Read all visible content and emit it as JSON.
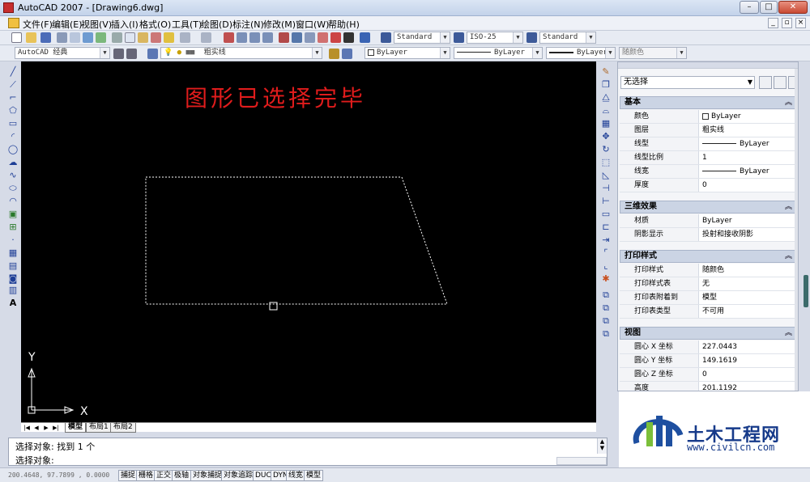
{
  "window": {
    "title": "AutoCAD 2007 - [Drawing6.dwg]",
    "minimize": "–",
    "maximize": "□",
    "close": "✕"
  },
  "menu": {
    "items": [
      "文件(F)",
      "编辑(E)",
      "视图(V)",
      "插入(I)",
      "格式(O)",
      "工具(T)",
      "绘图(D)",
      "标注(N)",
      "修改(M)",
      "窗口(W)",
      "帮助(H)"
    ],
    "mdi_minimize": "_",
    "mdi_restore": "▫",
    "mdi_close": "×"
  },
  "toolbar1": {
    "text_style": "Standard",
    "dim_style": "ISO-25",
    "table_style": "Standard"
  },
  "toolbar2": {
    "workspace": "AutoCAD 经典",
    "layer": "粗实线",
    "color": "ByLayer",
    "linetype": "ByLayer",
    "lineweight": "ByLayer",
    "plotstyle": "随颜色"
  },
  "drawing": {
    "annotation": "图形已选择完毕",
    "annotation_color": "#e01c1c",
    "ucs_y": "Y",
    "ucs_x": "X"
  },
  "layout_tabs": {
    "nav": [
      "|◀",
      "◀",
      "▶",
      "▶|"
    ],
    "tabs": [
      "模型",
      "布局1",
      "布局2"
    ]
  },
  "properties": {
    "selection": "无选择",
    "sections": [
      {
        "title": "基本",
        "rows": [
          {
            "label": "颜色",
            "value": "ByLayer"
          },
          {
            "label": "图层",
            "value": "粗实线"
          },
          {
            "label": "线型",
            "value": "ByLayer"
          },
          {
            "label": "线型比例",
            "value": "1"
          },
          {
            "label": "线宽",
            "value": "ByLayer"
          },
          {
            "label": "厚度",
            "value": "0"
          }
        ]
      },
      {
        "title": "三维效果",
        "rows": [
          {
            "label": "材质",
            "value": "ByLayer"
          },
          {
            "label": "阴影显示",
            "value": "投射和接收阴影"
          }
        ]
      },
      {
        "title": "打印样式",
        "rows": [
          {
            "label": "打印样式",
            "value": "随颜色"
          },
          {
            "label": "打印样式表",
            "value": "无"
          },
          {
            "label": "打印表附着到",
            "value": "模型"
          },
          {
            "label": "打印表类型",
            "value": "不可用"
          }
        ]
      },
      {
        "title": "视图",
        "rows": [
          {
            "label": "圆心 X 坐标",
            "value": "227.0443"
          },
          {
            "label": "圆心 Y 坐标",
            "value": "149.1619"
          },
          {
            "label": "圆心 Z 坐标",
            "value": "0"
          },
          {
            "label": "高度",
            "value": "201.1192"
          }
        ]
      }
    ]
  },
  "command": {
    "line1": "选择对象: 找到 1 个",
    "line2": "选择对象:"
  },
  "status": {
    "coords": "200.4648, 97.7899 , 0.0000",
    "buttons": [
      "捕捉",
      "栅格",
      "正交",
      "极轴",
      "对象捕捉",
      "对象追踪",
      "DUCS",
      "DYN",
      "线宽",
      "模型"
    ]
  },
  "watermark": {
    "name": "土木工程网",
    "url": "www.civilcn.com"
  }
}
